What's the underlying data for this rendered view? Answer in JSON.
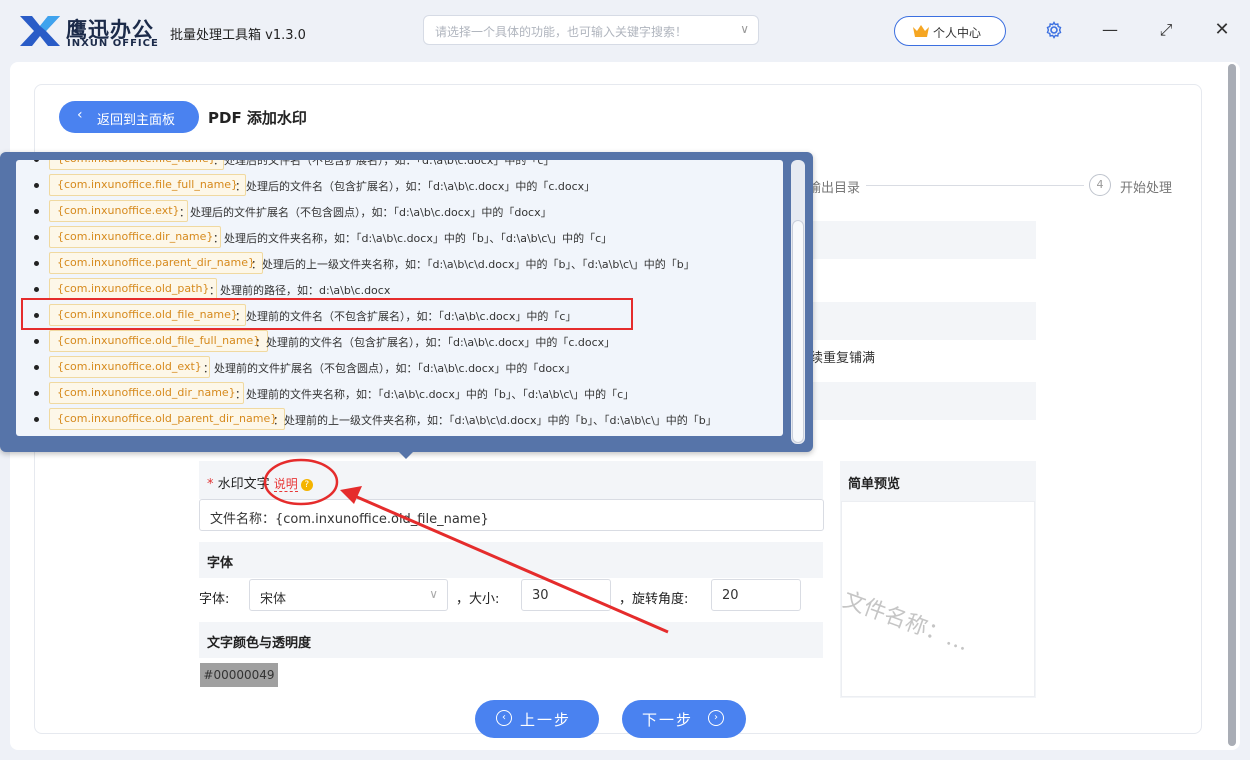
{
  "app": {
    "logo_cn": "鹰迅办公",
    "logo_en": "INXUN OFFICE",
    "title": "批量处理工具箱 v1.3.0"
  },
  "search": {
    "placeholder": "请选择一个具体的功能，也可输入关键字搜索！"
  },
  "user_center": "个人中心",
  "window_controls": [
    "gear-icon",
    "minimize-icon",
    "maximize-icon",
    "close-icon"
  ],
  "header": {
    "back_label": "返回到主面板",
    "page_title": "PDF 添加水印"
  },
  "steps": {
    "output_dir": "输出目录",
    "start_num": "4",
    "start": "开始处理"
  },
  "partial_text": "续重复铺满",
  "popup": {
    "items": [
      {
        "tag": "{com.inxunoffice.file_name}",
        "desc": "：处理后的文件名（不包含扩展名），如：「d:\\a\\b\\c.docx」中的「c」"
      },
      {
        "tag": "{com.inxunoffice.file_full_name}",
        "desc": "：处理后的文件名（包含扩展名），如：「d:\\a\\b\\c.docx」中的「c.docx」"
      },
      {
        "tag": "{com.inxunoffice.ext}",
        "desc": "：处理后的文件扩展名（不包含圆点），如：「d:\\a\\b\\c.docx」中的「docx」"
      },
      {
        "tag": "{com.inxunoffice.dir_name}",
        "desc": "：处理后的文件夹名称，如：「d:\\a\\b\\c.docx」中的「b」、「d:\\a\\b\\c\\」中的「c」"
      },
      {
        "tag": "{com.inxunoffice.parent_dir_name}",
        "desc": "：处理后的上一级文件夹名称，如：「d:\\a\\b\\c\\d.docx」中的「b」、「d:\\a\\b\\c\\」中的「b」"
      },
      {
        "tag": "{com.inxunoffice.old_path}",
        "desc": "：处理前的路径，如：d:\\a\\b\\c.docx"
      },
      {
        "tag": "{com.inxunoffice.old_file_name}",
        "desc": "：处理前的文件名（不包含扩展名），如：「d:\\a\\b\\c.docx」中的「c」"
      },
      {
        "tag": "{com.inxunoffice.old_file_full_name}",
        "desc": "：处理前的文件名（包含扩展名），如：「d:\\a\\b\\c.docx」中的「c.docx」"
      },
      {
        "tag": "{com.inxunoffice.old_ext}",
        "desc": "：处理前的文件扩展名（不包含圆点），如：「d:\\a\\b\\c.docx」中的「docx」"
      },
      {
        "tag": "{com.inxunoffice.old_dir_name}",
        "desc": "：处理前的文件夹名称，如：「d:\\a\\b\\c.docx」中的「b」、「d:\\a\\b\\c\\」中的「c」"
      },
      {
        "tag": "{com.inxunoffice.old_parent_dir_name}",
        "desc": "：处理前的上一级文件夹名称，如：「d:\\a\\b\\c\\d.docx」中的「b」、「d:\\a\\b\\c\\」中的「b」"
      }
    ]
  },
  "form": {
    "watermark_label": "水印文字",
    "explain": "说明",
    "watermark_value": "文件名称：{com.inxunoffice.old_file_name}",
    "font_section": "字体",
    "font_label": "字体:",
    "font_value": "宋体",
    "size_label": "，大小:",
    "size_value": "30",
    "rotate_label": "，旋转角度:",
    "rotate_value": "20",
    "color_section": "文字颜色与透明度",
    "color_value": "#00000049",
    "preview_title": "简单预览",
    "preview_text": "文件名称：…"
  },
  "nav": {
    "prev": "上一步",
    "next": "下一步"
  },
  "colors": {
    "accent": "#4a82f0",
    "popup_frame": "#5674a9",
    "annotation": "#e52c2c",
    "tag_text": "#d68a1d"
  }
}
